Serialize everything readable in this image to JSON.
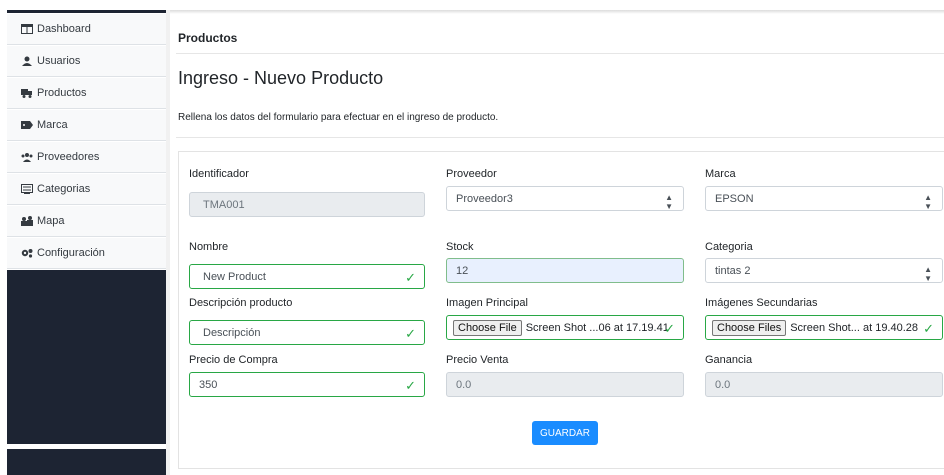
{
  "sidebar": {
    "items": [
      {
        "label": "Dashboard",
        "icon": "table-icon"
      },
      {
        "label": "Usuarios",
        "icon": "user-icon"
      },
      {
        "label": "Productos",
        "icon": "truck-icon"
      },
      {
        "label": "Marca",
        "icon": "tag-icon"
      },
      {
        "label": "Proveedores",
        "icon": "users-icon"
      },
      {
        "label": "Categorias",
        "icon": "list-icon"
      },
      {
        "label": "Mapa",
        "icon": "map-people-icon"
      },
      {
        "label": "Configuración",
        "icon": "gear-icon"
      }
    ]
  },
  "breadcrumb": "Productos",
  "page_title": "Ingreso - Nuevo Producto",
  "description": "Rellena los datos del formulario para efectuar en el ingreso de producto.",
  "form": {
    "identificador": {
      "label": "Identificador",
      "value": "TMA001"
    },
    "proveedor": {
      "label": "Proveedor",
      "value": "Proveedor3"
    },
    "marca": {
      "label": "Marca",
      "value": "EPSON"
    },
    "nombre": {
      "label": "Nombre",
      "value": "New Product"
    },
    "stock": {
      "label": "Stock",
      "value": "12"
    },
    "categoria": {
      "label": "Categoria",
      "value": "tintas 2"
    },
    "descripcion": {
      "label": "Descripción producto",
      "value": "Descripción"
    },
    "imagen_principal": {
      "label": "Imagen Principal",
      "button": "Choose File",
      "file": "Screen Shot ...06 at 17.19.41"
    },
    "imagenes_secundarias": {
      "label": "Imágenes Secundarias",
      "button": "Choose Files",
      "file": "Screen Shot... at 19.40.28"
    },
    "precio_compra": {
      "label": "Precio de Compra",
      "value": "350"
    },
    "precio_venta": {
      "label": "Precio Venta",
      "value": "0.0"
    },
    "ganancia": {
      "label": "Ganancia",
      "value": "0.0"
    }
  },
  "submit_label": "GUARDAR",
  "colors": {
    "sidebar_dark": "#1d2433",
    "valid": "#28a745",
    "primary": "#1a8cff"
  }
}
